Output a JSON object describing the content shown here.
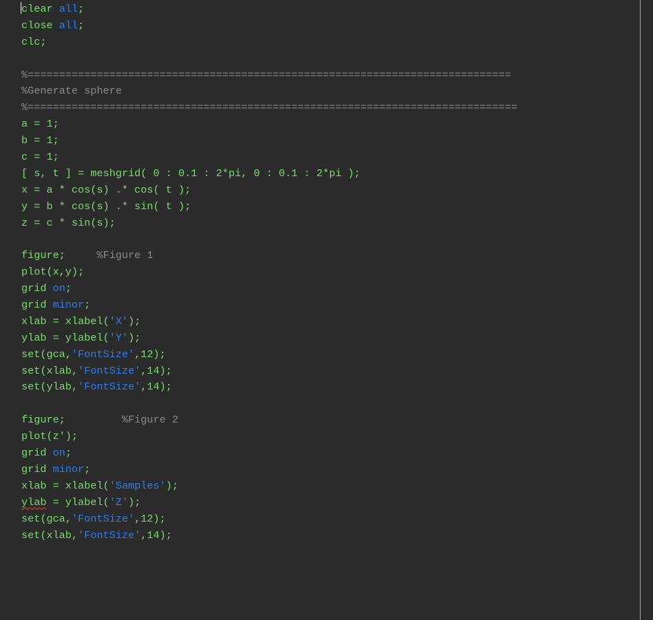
{
  "editor": {
    "colors": {
      "background": "#2b2b2b",
      "code": "#7ddc6f",
      "keyword": "#2f7cf3",
      "string": "#2f7cf3",
      "comment": "#8b8b8b",
      "error_underline": "#ff3b30",
      "margin_line": "#a8a8a8"
    },
    "lines": [
      [
        {
          "t": "code",
          "text": "clear "
        },
        {
          "t": "kw",
          "text": "all"
        },
        {
          "t": "code",
          "text": ";"
        }
      ],
      [
        {
          "t": "code",
          "text": "close "
        },
        {
          "t": "kw",
          "text": "all"
        },
        {
          "t": "code",
          "text": ";"
        }
      ],
      [
        {
          "t": "code",
          "text": "clc;"
        }
      ],
      [],
      [
        {
          "t": "cmt",
          "text": "%============================================================================="
        }
      ],
      [
        {
          "t": "cmt",
          "text": "%Generate sphere"
        }
      ],
      [
        {
          "t": "cmt",
          "text": "%=============================================================================="
        }
      ],
      [
        {
          "t": "code",
          "text": "a = 1;"
        }
      ],
      [
        {
          "t": "code",
          "text": "b = 1;"
        }
      ],
      [
        {
          "t": "code",
          "text": "c = 1;"
        }
      ],
      [
        {
          "t": "code",
          "text": "[ s, t ] = meshgrid( 0 : 0.1 : 2*pi, 0 : 0.1 : 2*pi );"
        }
      ],
      [
        {
          "t": "code",
          "text": "x = a * cos(s) .* cos( t );"
        }
      ],
      [
        {
          "t": "code",
          "text": "y = b * cos(s) .* sin( t );"
        }
      ],
      [
        {
          "t": "code",
          "text": "z = c * sin(s);"
        }
      ],
      [],
      [
        {
          "t": "code",
          "text": "figure;     "
        },
        {
          "t": "cmt",
          "text": "%Figure 1"
        }
      ],
      [
        {
          "t": "code",
          "text": "plot(x,y);"
        }
      ],
      [
        {
          "t": "code",
          "text": "grid "
        },
        {
          "t": "kw",
          "text": "on"
        },
        {
          "t": "code",
          "text": ";"
        }
      ],
      [
        {
          "t": "code",
          "text": "grid "
        },
        {
          "t": "kw",
          "text": "minor"
        },
        {
          "t": "code",
          "text": ";"
        }
      ],
      [
        {
          "t": "code",
          "text": "xlab = xlabel("
        },
        {
          "t": "str",
          "text": "'X'"
        },
        {
          "t": "code",
          "text": ");"
        }
      ],
      [
        {
          "t": "code",
          "text": "ylab = ylabel("
        },
        {
          "t": "str",
          "text": "'Y'"
        },
        {
          "t": "code",
          "text": ");"
        }
      ],
      [
        {
          "t": "code",
          "text": "set(gca,"
        },
        {
          "t": "str",
          "text": "'FontSize'"
        },
        {
          "t": "code",
          "text": ",12);"
        }
      ],
      [
        {
          "t": "code",
          "text": "set(xlab,"
        },
        {
          "t": "str",
          "text": "'FontSize'"
        },
        {
          "t": "code",
          "text": ",14);"
        }
      ],
      [
        {
          "t": "code",
          "text": "set(ylab,"
        },
        {
          "t": "str",
          "text": "'FontSize'"
        },
        {
          "t": "code",
          "text": ",14);"
        }
      ],
      [],
      [
        {
          "t": "code",
          "text": "figure;         "
        },
        {
          "t": "cmt",
          "text": "%Figure 2"
        }
      ],
      [
        {
          "t": "code",
          "text": "plot(z');"
        }
      ],
      [
        {
          "t": "code",
          "text": "grid "
        },
        {
          "t": "kw",
          "text": "on"
        },
        {
          "t": "code",
          "text": ";"
        }
      ],
      [
        {
          "t": "code",
          "text": "grid "
        },
        {
          "t": "kw",
          "text": "minor"
        },
        {
          "t": "code",
          "text": ";"
        }
      ],
      [
        {
          "t": "code",
          "text": "xlab = xlabel("
        },
        {
          "t": "str",
          "text": "'Samples'"
        },
        {
          "t": "code",
          "text": ");"
        }
      ],
      [
        {
          "t": "code",
          "text": "ylab",
          "err": true
        },
        {
          "t": "code",
          "text": " = ylabel("
        },
        {
          "t": "str",
          "text": "'Z'"
        },
        {
          "t": "code",
          "text": ");"
        }
      ],
      [
        {
          "t": "code",
          "text": "set(gca,"
        },
        {
          "t": "str",
          "text": "'FontSize'"
        },
        {
          "t": "code",
          "text": ",12);"
        }
      ],
      [
        {
          "t": "code",
          "text": "set(xlab,"
        },
        {
          "t": "str",
          "text": "'FontSize'"
        },
        {
          "t": "code",
          "text": ",14);"
        }
      ]
    ]
  }
}
